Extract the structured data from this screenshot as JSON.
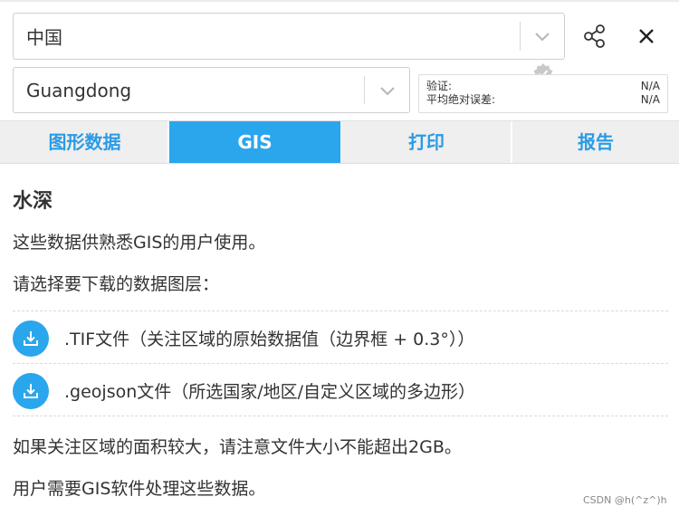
{
  "selectors": {
    "country": {
      "value": "中国"
    },
    "region": {
      "value": "Guangdong"
    }
  },
  "header_icons": {
    "share": "share-icon",
    "close": "close-icon",
    "badge": "verified-badge-icon"
  },
  "stats": [
    {
      "label": "验证:",
      "value": "N/A"
    },
    {
      "label": "平均绝对误差:",
      "value": "N/A"
    }
  ],
  "tabs": [
    {
      "label": "图形数据",
      "active": false
    },
    {
      "label": "GIS",
      "active": true
    },
    {
      "label": "打印",
      "active": false
    },
    {
      "label": "报告",
      "active": false
    }
  ],
  "content": {
    "heading": "水深",
    "intro": "这些数据供熟悉GIS的用户使用。",
    "prompt": "请选择要下载的数据图层：",
    "downloads": [
      {
        "label": ".TIF文件（关注区域的原始数据值（边界框 + 0.3°））",
        "icon": "download-icon"
      },
      {
        "label": ".geojson文件（所选国家/地区/自定义区域的多边形）",
        "icon": "download-icon"
      }
    ],
    "note_size": "如果关注区域的面积较大，请注意文件大小不能超出2GB。",
    "note_software": "用户需要GIS软件处理这些数据。"
  },
  "watermark": "CSDN @h(^z^)h",
  "colors": {
    "accent": "#2aa6ec",
    "tab_text": "#2a9be5",
    "tab_bg": "#efefef"
  }
}
